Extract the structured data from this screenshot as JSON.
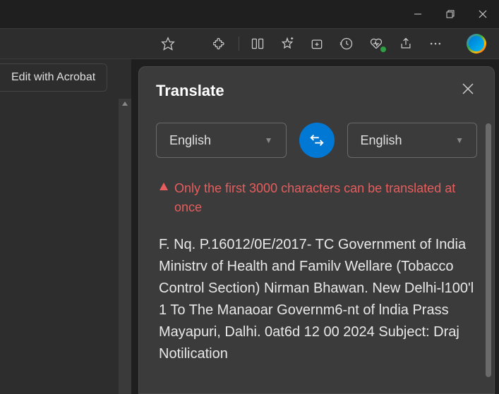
{
  "window": {
    "minimize": "minimize",
    "maximize": "maximize",
    "close": "close"
  },
  "toolbar": {
    "favorite": "star",
    "extensions": "puzzle",
    "split": "split-screen",
    "favorites": "star-plus",
    "collections": "add-collection",
    "history": "history",
    "performance": "heart-pulse",
    "share": "share",
    "more": "more",
    "copilot": "copilot"
  },
  "leftPanel": {
    "acrobatLabel": "Edit with Acrobat"
  },
  "translate": {
    "title": "Translate",
    "sourceLang": "English",
    "targetLang": "English",
    "warning": "Only the first 3000 characters can be translated at once",
    "body": "F. Nq. P.16012/0E/2017- TC Government of India Ministrv of Health and Familv Wellare (Tobacco Control Section) Nirman Bhawan. New Delhi-l100'l 1 To The Manaoar Governm6-nt of lndia Prass Mayapuri, Dalhi. 0at6d 12 00 2024 Subject: Draj Notilication"
  }
}
